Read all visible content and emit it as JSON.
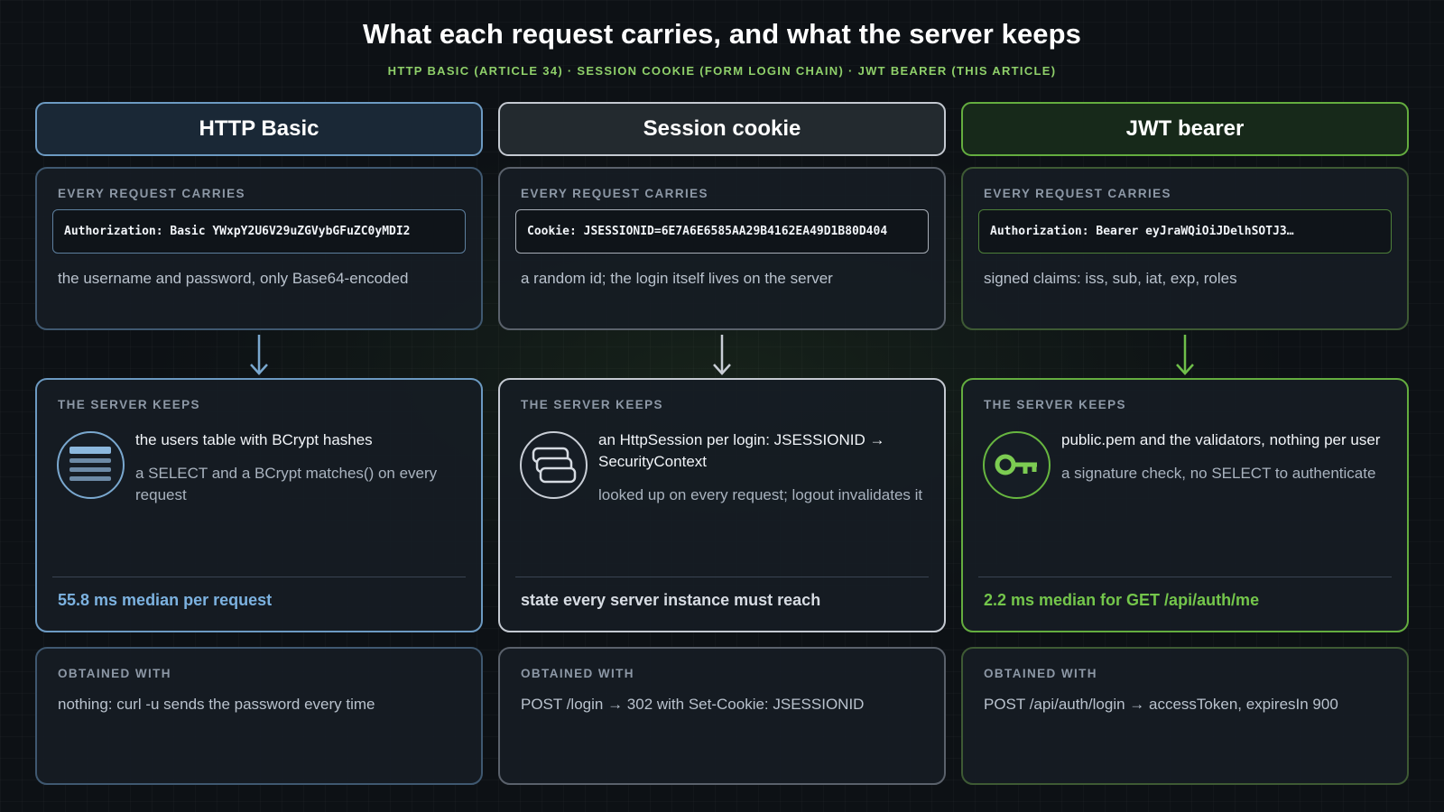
{
  "title": "What each request carries, and what the server keeps",
  "subtitle": "HTTP BASIC (ARTICLE 34) · SESSION COOKIE (FORM LOGIN CHAIN) · JWT BEARER (THIS ARTICLE)",
  "columns": [
    {
      "name": "HTTP Basic",
      "accent": "#6ea6d6",
      "carries_label": "EVERY REQUEST CARRIES",
      "header_value": "Authorization: Basic YWxpY2U6V29uZGVybGFuZC0yMDI2",
      "carries_desc": "the username and password, only Base64-encoded",
      "keeps_label": "THE SERVER KEEPS",
      "icon": "database-icon",
      "keeps_main": "the users table with BCrypt hashes",
      "keeps_sub": "a SELECT and a BCrypt matches() on every request",
      "footer": "55.8 ms median per request",
      "obtained_label": "OBTAINED WITH",
      "obtained_text": "nothing: curl -u sends the password every time"
    },
    {
      "name": "Session cookie",
      "accent": "#c9ced6",
      "carries_label": "EVERY REQUEST CARRIES",
      "header_value": "Cookie: JSESSIONID=6E7A6E6585AA29B4162EA49D1B80D404",
      "carries_desc": "a random id; the login itself lives on the server",
      "keeps_label": "THE SERVER KEEPS",
      "icon": "session-stack-icon",
      "keeps_main": "an HttpSession per login: JSESSIONID → SecurityContext",
      "keeps_sub": "looked up on every request; logout invalidates it",
      "footer": "state every server instance must reach",
      "obtained_label": "OBTAINED WITH",
      "obtained_text": "POST /login → 302 with Set-Cookie: JSESSIONID"
    },
    {
      "name": "JWT bearer",
      "accent": "#6fbf4a",
      "carries_label": "EVERY REQUEST CARRIES",
      "header_value": "Authorization: Bearer eyJraWQiOiJDelhSOTJ3…",
      "carries_desc": "signed claims: iss, sub, iat, exp, roles",
      "keeps_label": "THE SERVER KEEPS",
      "icon": "key-icon",
      "keeps_main": "public.pem and the validators, nothing per user",
      "keeps_sub": "a signature check, no SELECT to authenticate",
      "footer": "2.2 ms median for GET /api/auth/me",
      "obtained_label": "OBTAINED WITH",
      "obtained_text": "POST /api/auth/login → accessToken, expiresIn 900"
    }
  ]
}
